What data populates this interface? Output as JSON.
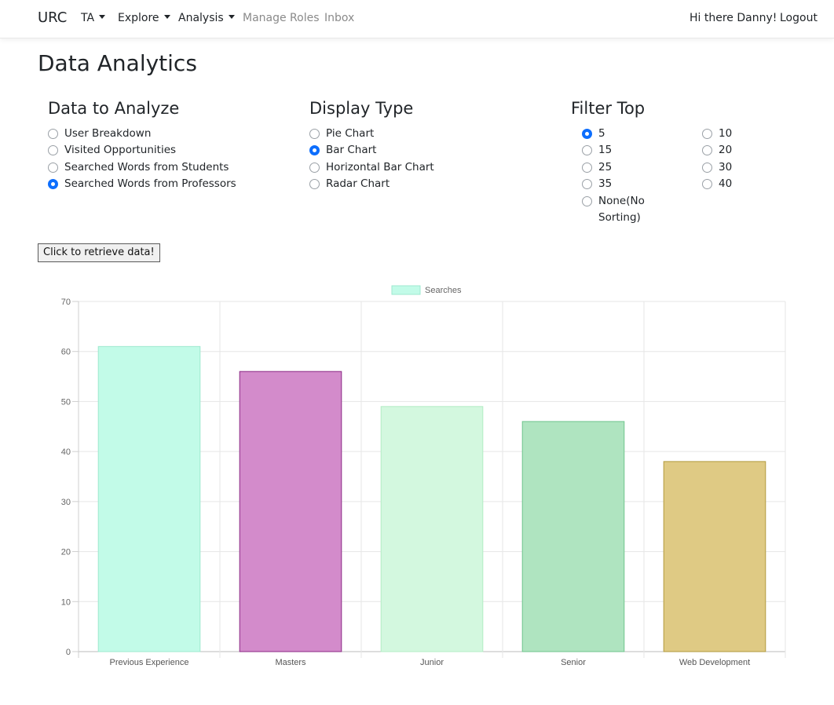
{
  "navbar": {
    "brand": "URC",
    "items": [
      {
        "label": "TA",
        "dropdown": true
      },
      {
        "label": "Explore",
        "dropdown": true
      },
      {
        "label": "Analysis",
        "dropdown": true
      },
      {
        "label": "Manage Roles",
        "dropdown": false
      },
      {
        "label": "Inbox",
        "dropdown": false
      }
    ],
    "greeting": "Hi there Danny!",
    "logout": "Logout"
  },
  "page": {
    "title": "Data Analytics"
  },
  "data_to_analyze": {
    "heading": "Data to Analyze",
    "options": [
      {
        "label": "User Breakdown",
        "checked": false
      },
      {
        "label": "Visited Opportunities",
        "checked": false
      },
      {
        "label": "Searched Words from Students",
        "checked": false
      },
      {
        "label": "Searched Words from Professors",
        "checked": true
      }
    ]
  },
  "display_type": {
    "heading": "Display Type",
    "options": [
      {
        "label": "Pie Chart",
        "checked": false
      },
      {
        "label": "Bar Chart",
        "checked": true
      },
      {
        "label": "Horizontal Bar Chart",
        "checked": false
      },
      {
        "label": "Radar Chart",
        "checked": false
      }
    ]
  },
  "filter_top": {
    "heading": "Filter Top",
    "left_options": [
      {
        "label": "5",
        "checked": true
      },
      {
        "label": "15",
        "checked": false
      },
      {
        "label": "25",
        "checked": false
      },
      {
        "label": "35",
        "checked": false
      }
    ],
    "right_options": [
      {
        "label": "10",
        "checked": false
      },
      {
        "label": "20",
        "checked": false
      },
      {
        "label": "30",
        "checked": false
      },
      {
        "label": "40",
        "checked": false
      }
    ],
    "none_line1": "None(No",
    "none_line2": "Sorting)"
  },
  "retrieve_button": "Click to retrieve data!",
  "chart_data": {
    "type": "bar",
    "categories": [
      "Previous Experience",
      "Masters",
      "Junior",
      "Senior",
      "Web Development"
    ],
    "series": [
      {
        "name": "Searches",
        "values": [
          61,
          56,
          49,
          46,
          38
        ]
      }
    ],
    "ylim": [
      0,
      70
    ],
    "yticks": [
      0,
      10,
      20,
      30,
      40,
      50,
      60,
      70
    ],
    "legend_position": "top",
    "grid": true,
    "bar_colors": [
      {
        "fill": "#c2fbe8",
        "stroke": "#9ee8cf"
      },
      {
        "fill": "#d38bcb",
        "stroke": "#8b2a86"
      },
      {
        "fill": "#d3f8df",
        "stroke": "#b3ecc4"
      },
      {
        "fill": "#afe4c0",
        "stroke": "#6fc48d"
      },
      {
        "fill": "#dfca84",
        "stroke": "#b19a3c"
      }
    ]
  }
}
